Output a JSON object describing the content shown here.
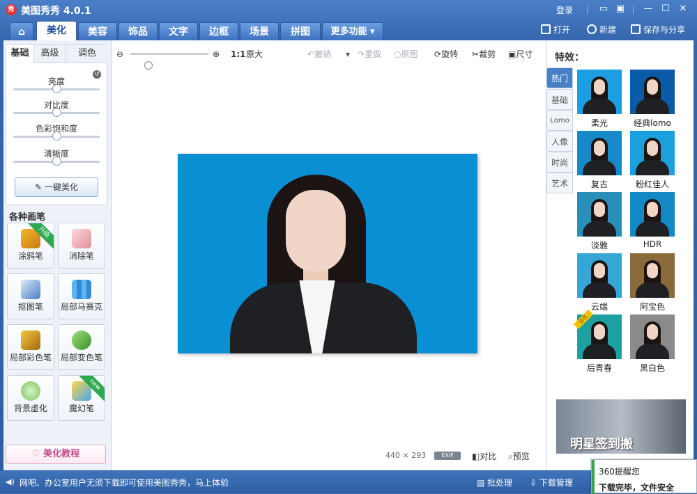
{
  "app": {
    "title": "美图秀秀 4.0.1",
    "logo_text": "秀"
  },
  "titlebar": {
    "login": "登录",
    "buttons": [
      "message-icon",
      "skin-icon",
      "minimize-icon",
      "maximize-icon",
      "close-icon"
    ]
  },
  "nav": {
    "home_icon": "home-icon",
    "tabs": [
      {
        "label": "美化",
        "active": true
      },
      {
        "label": "美容",
        "active": false
      },
      {
        "label": "饰品",
        "active": false
      },
      {
        "label": "文字",
        "active": false
      },
      {
        "label": "边框",
        "active": false
      },
      {
        "label": "场景",
        "active": false
      },
      {
        "label": "拼图",
        "active": false
      }
    ],
    "more": "更多功能",
    "actions": {
      "open": "打开",
      "new": "新建",
      "save": "保存与分享"
    }
  },
  "left": {
    "subtabs": [
      "基础",
      "高级",
      "调色"
    ],
    "sliders": [
      {
        "label": "亮度",
        "value": 0.5
      },
      {
        "label": "对比度",
        "value": 0.5
      },
      {
        "label": "色彩饱和度",
        "value": 0.5
      },
      {
        "label": "清晰度",
        "value": 0.5
      }
    ],
    "one_click": "一键美化",
    "brushes_title": "各种画笔",
    "brushes": [
      {
        "label": "涂鸦笔",
        "badge": "升级"
      },
      {
        "label": "消除笔",
        "badge": ""
      },
      {
        "label": "抠图笔",
        "badge": ""
      },
      {
        "label": "局部马赛克",
        "badge": ""
      },
      {
        "label": "局部彩色笔",
        "badge": ""
      },
      {
        "label": "局部变色笔",
        "badge": ""
      },
      {
        "label": "背景虚化",
        "badge": ""
      },
      {
        "label": "魔幻笔",
        "badge": "new"
      }
    ],
    "tutorial": "美化教程"
  },
  "toolbar": {
    "zoom_ratio": "1:1",
    "original_size": "原大",
    "undo": "撤销",
    "redo": "重做",
    "original": "原图",
    "rotate": "旋转",
    "crop": "裁剪",
    "size": "尺寸"
  },
  "image": {
    "width": "440",
    "times": "×",
    "height": "293",
    "exif": "EXIF",
    "compare": "对比",
    "preview": "预览"
  },
  "right": {
    "title": "特效：",
    "categories": [
      "热门",
      "基础",
      "Lomo",
      "人像",
      "时尚",
      "艺术"
    ],
    "effects": [
      {
        "label": "柔光",
        "bg": "#1d9ee0",
        "badge": ""
      },
      {
        "label": "经典lomo",
        "bg": "#0a5aa8",
        "badge": ""
      },
      {
        "label": "复古",
        "bg": "#1789c8",
        "badge": ""
      },
      {
        "label": "粉红佳人",
        "bg": "#1aa0dc",
        "badge": ""
      },
      {
        "label": "淡雅",
        "bg": "#2a8fb8",
        "badge": ""
      },
      {
        "label": "HDR",
        "bg": "#1288c4",
        "badge": ""
      },
      {
        "label": "云端",
        "bg": "#35a6d6",
        "badge": ""
      },
      {
        "label": "阿宝色",
        "bg": "#8a6a3a",
        "badge": ""
      },
      {
        "label": "后青春",
        "bg": "#1fa0a0",
        "badge": "会员"
      },
      {
        "label": "黑白色",
        "bg": "#8a8a8a",
        "badge": ""
      }
    ],
    "ad_text": "明星签到搬"
  },
  "status": {
    "message": "网吧、办公室用户无须下载即可使用美图秀秀，马上体验",
    "batch": "批处理",
    "download": "下载管理"
  },
  "popup": {
    "title": "360提醒您",
    "message": "下载完毕，文件安全"
  }
}
